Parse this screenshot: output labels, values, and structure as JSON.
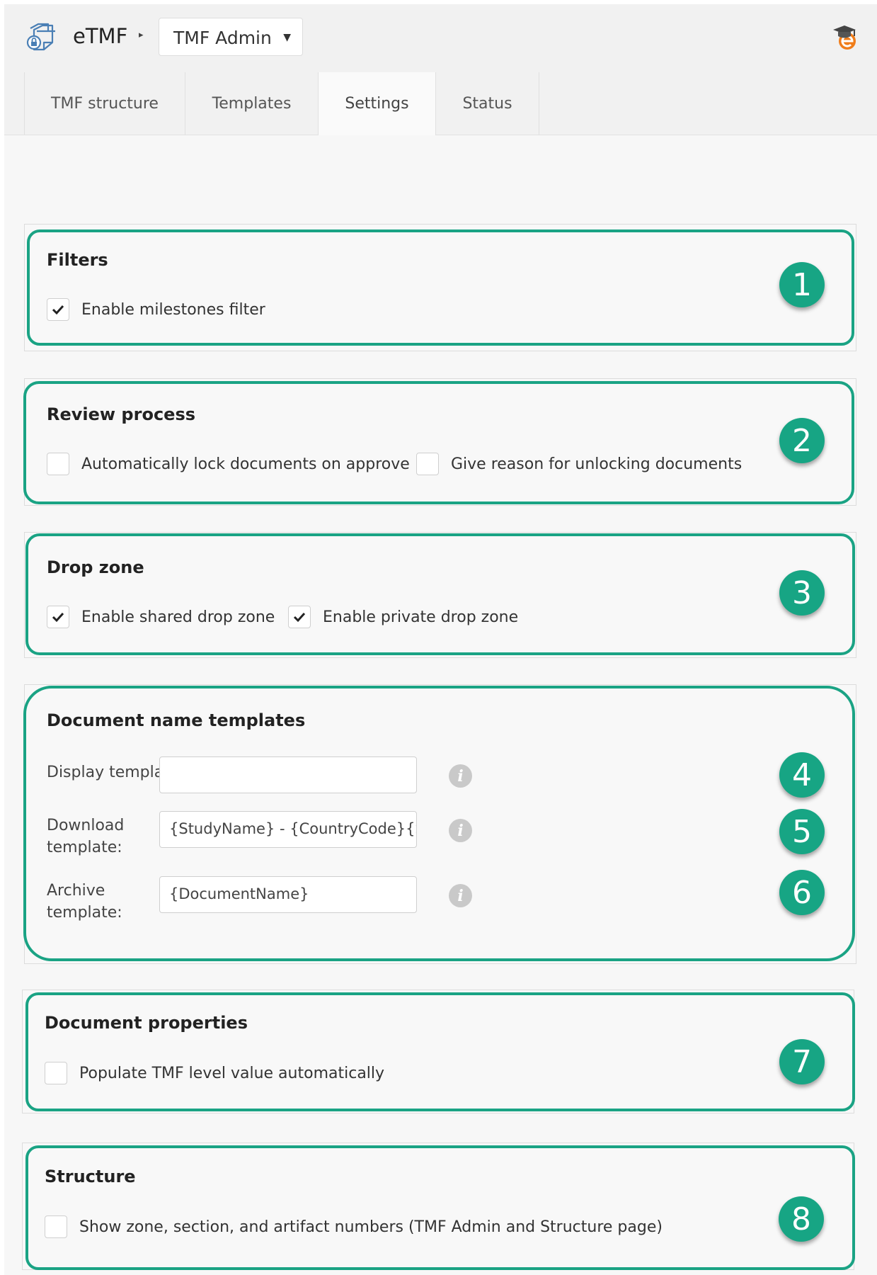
{
  "header": {
    "app_name": "eTMF",
    "dropdown_label": "TMF Admin"
  },
  "tabs": [
    {
      "label": "TMF structure"
    },
    {
      "label": "Templates"
    },
    {
      "label": "Settings"
    },
    {
      "label": "Status"
    }
  ],
  "active_tab": "Settings",
  "accent_color": "#1aa384",
  "sections": {
    "filters": {
      "title": "Filters",
      "badge": "1",
      "enable_milestones": {
        "label": "Enable milestones filter",
        "checked": true
      }
    },
    "review": {
      "title": "Review process",
      "badge": "2",
      "auto_lock": {
        "label": "Automatically lock documents on approve",
        "checked": false
      },
      "give_reason": {
        "label": "Give reason for unlocking documents",
        "checked": false
      }
    },
    "dropzone": {
      "title": "Drop zone",
      "badge": "3",
      "shared": {
        "label": "Enable shared drop zone",
        "checked": true
      },
      "private": {
        "label": "Enable private drop zone",
        "checked": true
      }
    },
    "doc_name_templates": {
      "title": "Document name templates",
      "display": {
        "label": "Display template:",
        "value": "",
        "badge": "4"
      },
      "download": {
        "label_line1": "Download",
        "label_line2": "template:",
        "value": "{StudyName} - {CountryCode}{SiteName}",
        "badge": "5"
      },
      "archive": {
        "label_line1": "Archive",
        "label_line2": "template:",
        "value": "{DocumentName}",
        "badge": "6"
      }
    },
    "doc_properties": {
      "title": "Document properties",
      "badge": "7",
      "populate": {
        "label": "Populate TMF level value automatically",
        "checked": false
      }
    },
    "structure": {
      "title": "Structure",
      "badge": "8",
      "show_numbers": {
        "label": "Show zone, section, and artifact numbers (TMF Admin and Structure page)",
        "checked": false
      }
    }
  }
}
